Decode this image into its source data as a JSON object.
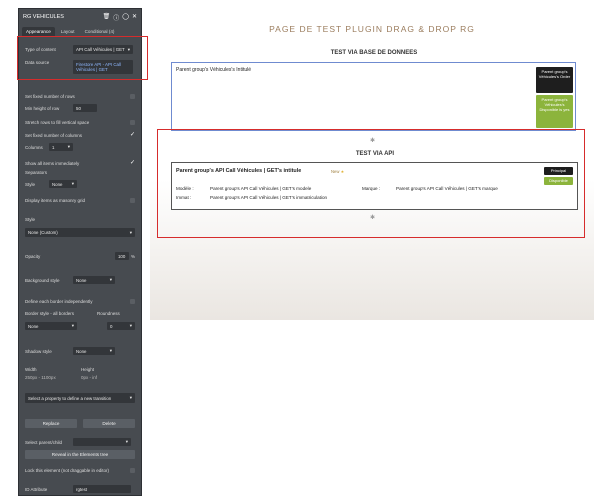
{
  "panel": {
    "title": "RG VEHICULES",
    "tabs": [
      "Appearance",
      "Layout",
      "Conditional (4)"
    ],
    "type_of_content_label": "Type of content",
    "type_of_content_value": "API Call Véhicules | GET",
    "data_source_label": "Data source",
    "data_source_value": "Firestore API - API Call Véhicules | GET",
    "fixed_rows_label": "Set fixed number of rows",
    "min_height_label": "Min height of row",
    "min_height_value": "50",
    "stretch_label": "Stretch rows to fill vertical space",
    "fixed_columns_label": "Set fixed number of columns",
    "columns_label": "Columns",
    "columns_value": "1",
    "show_items_label": "Show all items immediately",
    "separators_label": "Separators",
    "style_label": "Style",
    "style_value": "None",
    "masonry_label": "Display items as masonry grid",
    "style2_label": "Style",
    "style2_value": "None (Custom)",
    "opacity_label": "Opacity",
    "opacity_value": "100",
    "opacity_unit": "%",
    "bg_style_label": "Background style",
    "bg_style_value": "None",
    "border_each_label": "Define each border independently",
    "border_style_label": "Border style - all borders",
    "roundness_label": "Roundness",
    "border_value": "None",
    "roundness_value": "0",
    "shadow_label": "Shadow style",
    "shadow_value": "None",
    "width_label": "Width",
    "width_value": "250px - 1100px",
    "height_label": "Height",
    "height_value": "0px - inf",
    "transition_placeholder": "Select a property to define a new transition",
    "replace_label": "Replace",
    "delete_label": "Delete",
    "parent_child_label": "Select parent/child",
    "reveal_label": "Reveal in the Elements tree",
    "lock_label": "Lock this element (not draggable in editor)",
    "id_attr_label": "ID Attribute",
    "id_attr_value": "rgtest"
  },
  "canvas": {
    "page_title": "PAGE DE TEST PLUGIN DRAG & DROP RG",
    "db_section_title": "TEST VIA BASE DE DONNEES",
    "db_group_text": "Parent group's Véhicules's Intitulé",
    "db_badge_order": "Parent group's Véhicules's Order",
    "db_badge_dispo": "Parent group's Véhicules's Disponible is yes",
    "api_section_title": "TEST VIA API",
    "api_intitule": "Parent group's API Call Véhicules | GET's intitule",
    "api_new": "New",
    "api_badge_principal": "Principal",
    "api_badge_dispo": "Disponible",
    "modele_label": "Modèle :",
    "modele_value": "Parent group's API Call Véhicules | GET's modele",
    "marque_label": "Marque :",
    "marque_value": "Parent group's API Call Véhicules | GET's marque",
    "immat_label": "Immat :",
    "immat_value": "Parent group's API Call Véhicules | GET's immatriculation"
  },
  "colors": {
    "highlight": "#d62c2c",
    "badge_dark": "#1e1e1e",
    "badge_green": "#8cb43c",
    "title_brown": "#9b7d5e"
  }
}
